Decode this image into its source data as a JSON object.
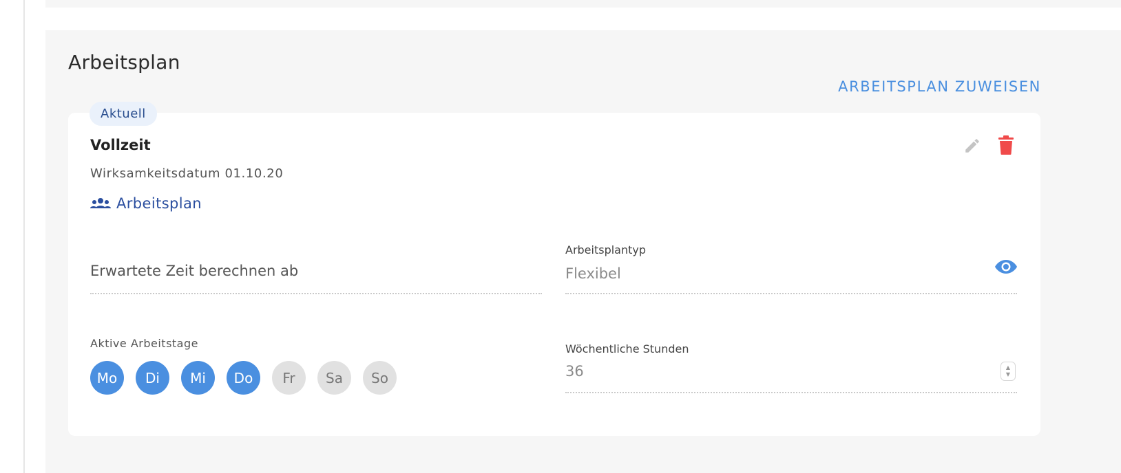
{
  "section": {
    "title": "Arbeitsplan",
    "assign_link": "ARBEITSPLAN ZUWEISEN"
  },
  "card": {
    "badge": "Aktuell",
    "plan_name": "Vollzeit",
    "effective_date": "Wirksamkeitsdatum 01.10.20",
    "plan_link": "Arbeitsplan",
    "icons": {
      "edit": "pencil-icon",
      "delete": "trash-icon",
      "group": "group-icon",
      "view": "eye-icon"
    },
    "colors": {
      "accent": "#4a8fe0",
      "link": "#2a4e9f",
      "delete": "#f04a4a"
    }
  },
  "fields": {
    "expected_time": {
      "value": "Erwartete Zeit berechnen ab"
    },
    "plan_type": {
      "label": "Arbeitsplantyp",
      "value": "Flexibel"
    },
    "active_days": {
      "label": "Aktive Arbeitstage",
      "days": [
        {
          "label": "Mo",
          "active": true
        },
        {
          "label": "Di",
          "active": true
        },
        {
          "label": "Mi",
          "active": true
        },
        {
          "label": "Do",
          "active": true
        },
        {
          "label": "Fr",
          "active": false
        },
        {
          "label": "Sa",
          "active": false
        },
        {
          "label": "So",
          "active": false
        }
      ]
    },
    "weekly_hours": {
      "label": "Wöchentliche Stunden",
      "value": "36"
    }
  }
}
